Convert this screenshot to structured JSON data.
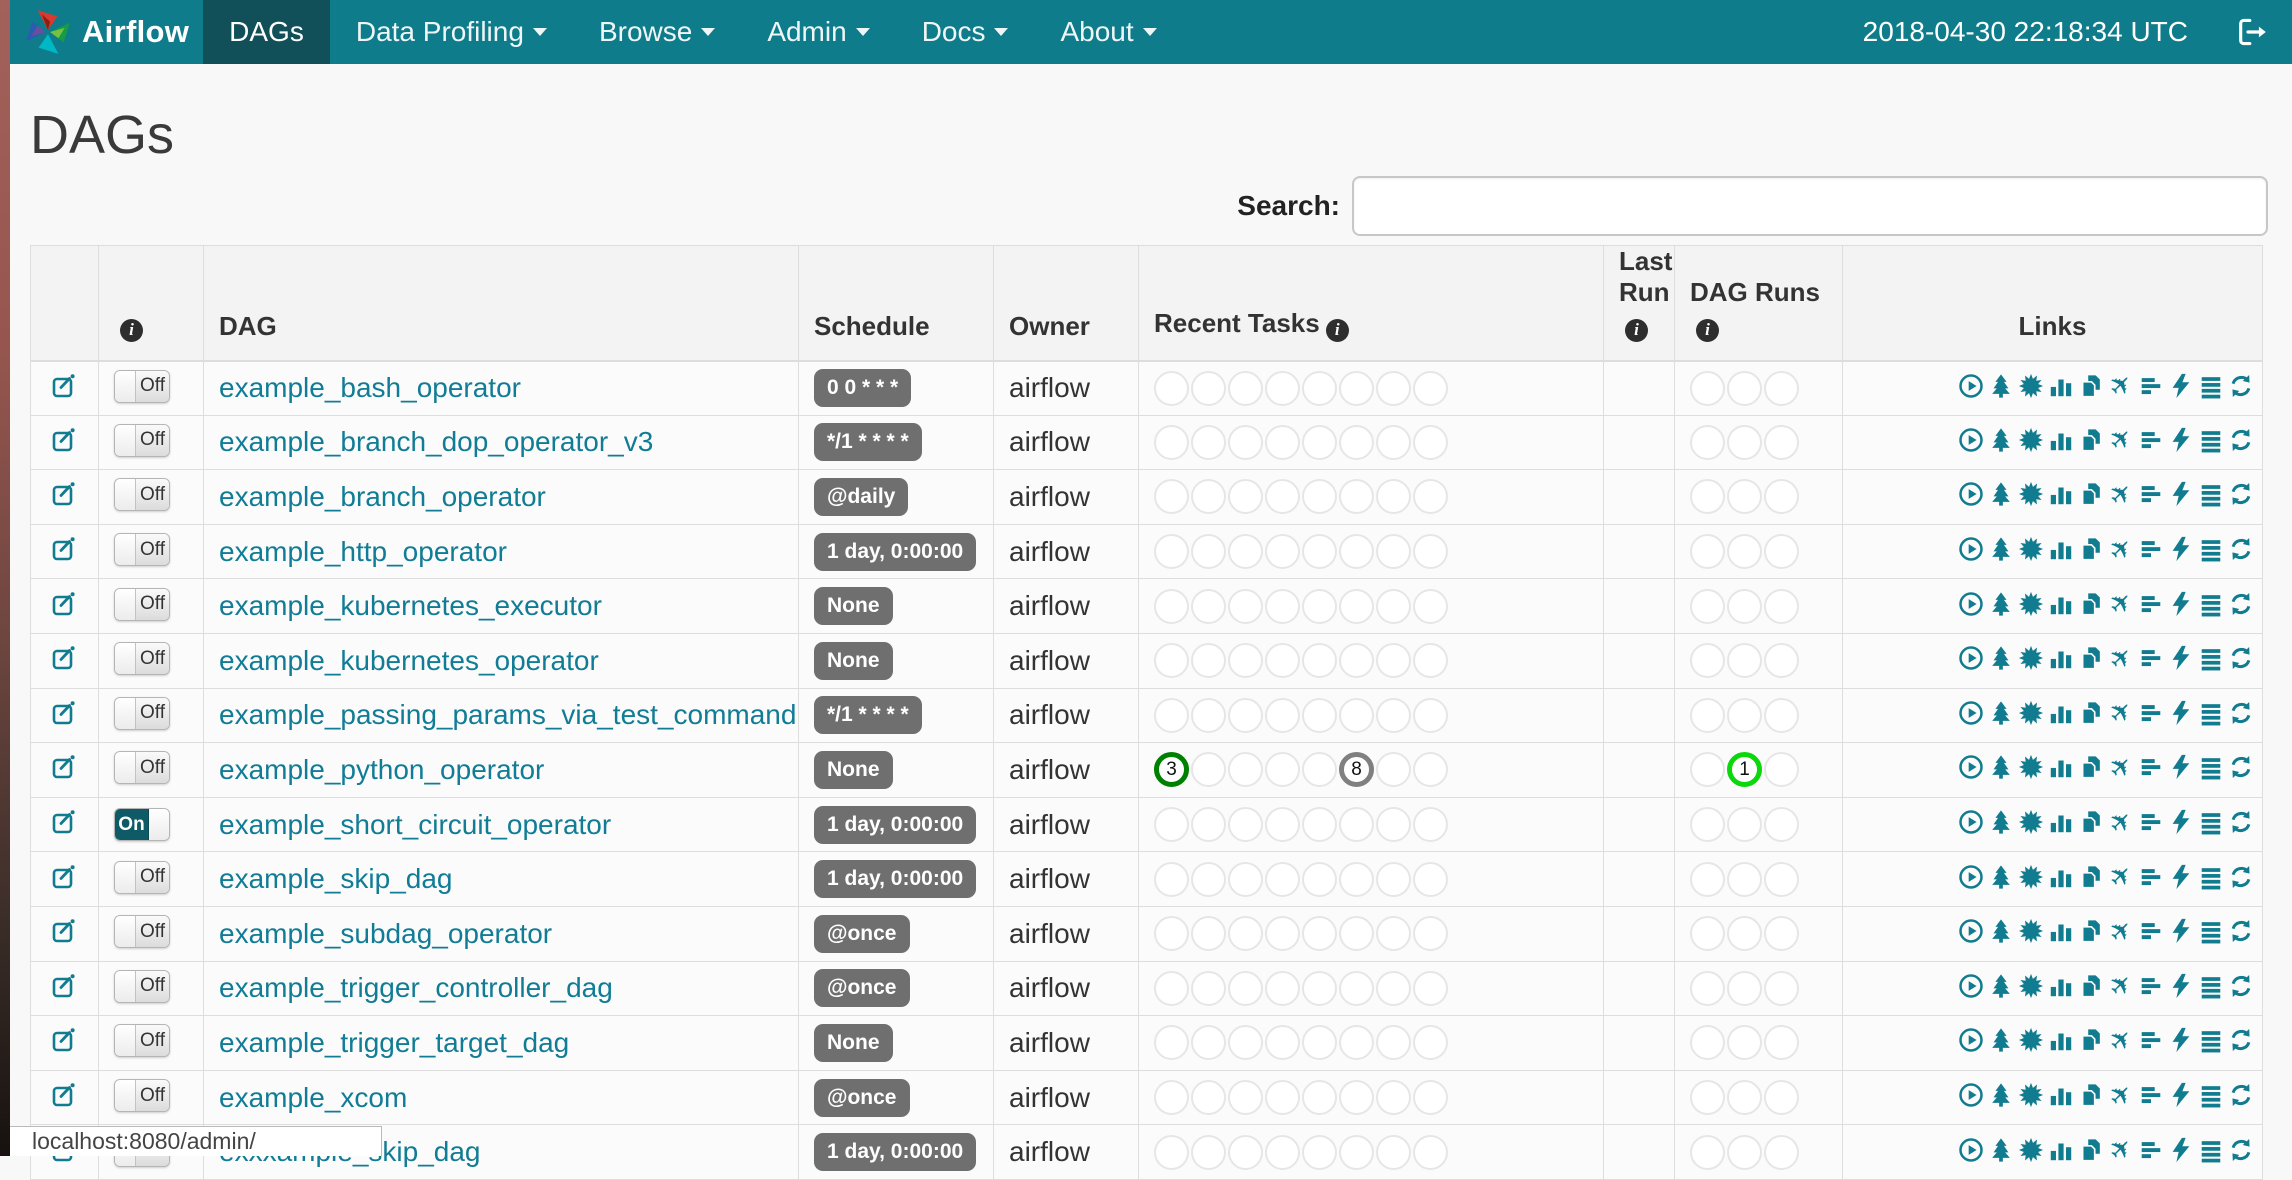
{
  "nav": {
    "brand": "Airflow",
    "items": [
      {
        "label": "DAGs",
        "active": true,
        "caret": false
      },
      {
        "label": "Data Profiling",
        "active": false,
        "caret": true
      },
      {
        "label": "Browse",
        "active": false,
        "caret": true
      },
      {
        "label": "Admin",
        "active": false,
        "caret": true
      },
      {
        "label": "Docs",
        "active": false,
        "caret": true
      },
      {
        "label": "About",
        "active": false,
        "caret": true
      }
    ],
    "clock": "2018-04-30 22:18:34 UTC"
  },
  "page": {
    "title": "DAGs",
    "search_label": "Search:",
    "search_value": "",
    "status_bar": "localhost:8080/admin/"
  },
  "colors": {
    "navbar": "#0e7c8a",
    "navbar_active": "#114f59",
    "accent": "#117c8f",
    "link": "#117c95",
    "badge": "#6f6f6f",
    "states": {
      "success": "#008000",
      "queued": "#808080",
      "running": "#0bd80b"
    }
  },
  "table": {
    "headers": {
      "dag": "DAG",
      "schedule": "Schedule",
      "owner": "Owner",
      "recent_tasks": "Recent Tasks",
      "last_run": "Last Run",
      "dag_runs": "DAG Runs",
      "links": "Links"
    },
    "recent_task_slots": 8,
    "dag_run_slots": 3,
    "link_icons": [
      "trigger-dag",
      "tree-view",
      "graph-view",
      "task-duration",
      "task-tries",
      "landing-times",
      "gantt",
      "code",
      "logs",
      "refresh"
    ],
    "rows": [
      {
        "dag": "example_bash_operator",
        "enabled": false,
        "toggle_label": "Off",
        "schedule": "0 0 * * *",
        "owner": "airflow",
        "recent_tasks": [],
        "dag_runs": []
      },
      {
        "dag": "example_branch_dop_operator_v3",
        "enabled": false,
        "toggle_label": "Off",
        "schedule": "*/1 * * * *",
        "owner": "airflow",
        "recent_tasks": [],
        "dag_runs": []
      },
      {
        "dag": "example_branch_operator",
        "enabled": false,
        "toggle_label": "Off",
        "schedule": "@daily",
        "owner": "airflow",
        "recent_tasks": [],
        "dag_runs": []
      },
      {
        "dag": "example_http_operator",
        "enabled": false,
        "toggle_label": "Off",
        "schedule": "1 day, 0:00:00",
        "owner": "airflow",
        "recent_tasks": [],
        "dag_runs": []
      },
      {
        "dag": "example_kubernetes_executor",
        "enabled": false,
        "toggle_label": "Off",
        "schedule": "None",
        "owner": "airflow",
        "recent_tasks": [],
        "dag_runs": []
      },
      {
        "dag": "example_kubernetes_operator",
        "enabled": false,
        "toggle_label": "Off",
        "schedule": "None",
        "owner": "airflow",
        "recent_tasks": [],
        "dag_runs": []
      },
      {
        "dag": "example_passing_params_via_test_command",
        "enabled": false,
        "toggle_label": "Off",
        "schedule": "*/1 * * * *",
        "owner": "airflow",
        "recent_tasks": [],
        "dag_runs": []
      },
      {
        "dag": "example_python_operator",
        "enabled": false,
        "toggle_label": "Off",
        "schedule": "None",
        "owner": "airflow",
        "recent_tasks": [
          {
            "slot": 0,
            "count": 3,
            "state": "success"
          },
          {
            "slot": 5,
            "count": 8,
            "state": "queued"
          }
        ],
        "dag_runs": [
          {
            "slot": 1,
            "count": 1,
            "state": "running"
          }
        ]
      },
      {
        "dag": "example_short_circuit_operator",
        "enabled": true,
        "toggle_label": "On",
        "schedule": "1 day, 0:00:00",
        "owner": "airflow",
        "recent_tasks": [],
        "dag_runs": []
      },
      {
        "dag": "example_skip_dag",
        "enabled": false,
        "toggle_label": "Off",
        "schedule": "1 day, 0:00:00",
        "owner": "airflow",
        "recent_tasks": [],
        "dag_runs": []
      },
      {
        "dag": "example_subdag_operator",
        "enabled": false,
        "toggle_label": "Off",
        "schedule": "@once",
        "owner": "airflow",
        "recent_tasks": [],
        "dag_runs": []
      },
      {
        "dag": "example_trigger_controller_dag",
        "enabled": false,
        "toggle_label": "Off",
        "schedule": "@once",
        "owner": "airflow",
        "recent_tasks": [],
        "dag_runs": []
      },
      {
        "dag": "example_trigger_target_dag",
        "enabled": false,
        "toggle_label": "Off",
        "schedule": "None",
        "owner": "airflow",
        "recent_tasks": [],
        "dag_runs": []
      },
      {
        "dag": "example_xcom",
        "enabled": false,
        "toggle_label": "Off",
        "schedule": "@once",
        "owner": "airflow",
        "recent_tasks": [],
        "dag_runs": []
      },
      {
        "dag": "exxxample_skip_dag",
        "enabled": false,
        "toggle_label": "Off",
        "schedule": "1 day, 0:00:00",
        "owner": "airflow",
        "recent_tasks": [],
        "dag_runs": []
      }
    ]
  }
}
